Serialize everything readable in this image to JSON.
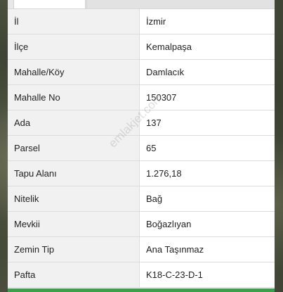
{
  "watermark": "emlakjet.com",
  "rows": [
    {
      "label": "İl",
      "value": "İzmir"
    },
    {
      "label": "İlçe",
      "value": "Kemalpaşa"
    },
    {
      "label": "Mahalle/Köy",
      "value": "Damlacık"
    },
    {
      "label": "Mahalle No",
      "value": "150307"
    },
    {
      "label": "Ada",
      "value": "137"
    },
    {
      "label": "Parsel",
      "value": "65"
    },
    {
      "label": "Tapu Alanı",
      "value": "1.276,18"
    },
    {
      "label": "Nitelik",
      "value": "Bağ"
    },
    {
      "label": "Mevkii",
      "value": "Boğazlıyan"
    },
    {
      "label": "Zemin Tip",
      "value": "Ana Taşınmaz"
    },
    {
      "label": "Pafta",
      "value": "K18-C-23-D-1"
    }
  ]
}
